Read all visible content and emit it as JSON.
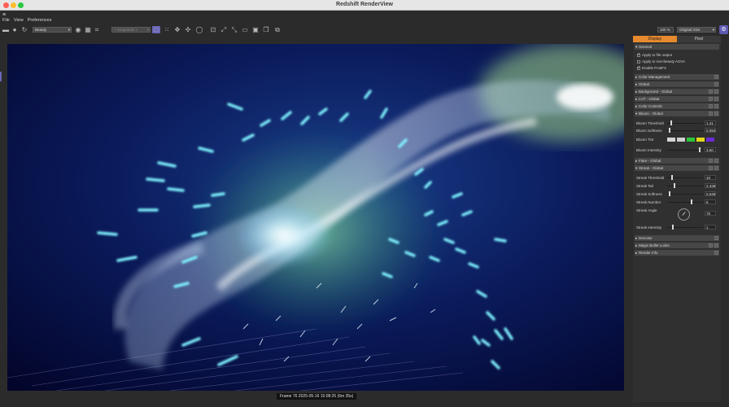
{
  "window": {
    "title": "Redshift RenderView"
  },
  "menu": [
    "File",
    "View",
    "Preferences"
  ],
  "toolbar": {
    "aov_select": "Beauty",
    "snapshot_select": "< Snapshots >",
    "zoom": "100 %",
    "size_select": "Original Size"
  },
  "status": {
    "text": "Frame  76   2025-05-16  15:08:25  (6m 35s)"
  },
  "panel": {
    "tabs": [
      "Display",
      "Pixel"
    ],
    "active_tab": "Display",
    "sections": {
      "general": "General",
      "color_management": "Color Management",
      "global": "Global",
      "background": "Background - Global",
      "lut": "LUT - Global",
      "color_controls": "Color Controls",
      "bloom": "Bloom - Global",
      "flare": "Flare - Global",
      "streak": "Streak - Global",
      "denoise": "Denoise",
      "magic_bullet": "Magic Bullet Looks",
      "render_info": "Render Info"
    },
    "general": {
      "apply_file_output": {
        "label": "Apply to file output",
        "checked": true
      },
      "apply_non_beauty": {
        "label": "Apply to non-beauty AOVs",
        "checked": false
      },
      "enable_postfx": {
        "label": "Enable PostFX",
        "checked": true
      }
    },
    "bloom": {
      "threshold": {
        "label": "Bloom Threshold",
        "value": "1.41",
        "fraction": 0.1
      },
      "softness": {
        "label": "Bloom Softness",
        "value": "0.094",
        "fraction": 0.05
      },
      "tint": {
        "label": "Bloom Tint",
        "colors": [
          "#d6d6d6",
          "#cfcfcf",
          "#2ec43a",
          "#e2d61a",
          "#6b2bd6"
        ]
      },
      "intensity": {
        "label": "Bloom Intensity",
        "value": "3.60",
        "fraction": 0.92
      }
    },
    "streak": {
      "threshold": {
        "label": "Streak Threshold",
        "value": "10",
        "fraction": 0.12
      },
      "tail": {
        "label": "Streak Tail",
        "value": "2.436",
        "fraction": 0.18
      },
      "softness": {
        "label": "Streak Softness",
        "value": "0.046",
        "fraction": 0.04
      },
      "number": {
        "label": "Streak Number",
        "value": "6",
        "fraction": 0.7
      },
      "angle": {
        "label": "Streak Angle",
        "value": "76"
      },
      "intensity": {
        "label": "Streak Intensity",
        "value": "1",
        "fraction": 0.15
      }
    }
  }
}
